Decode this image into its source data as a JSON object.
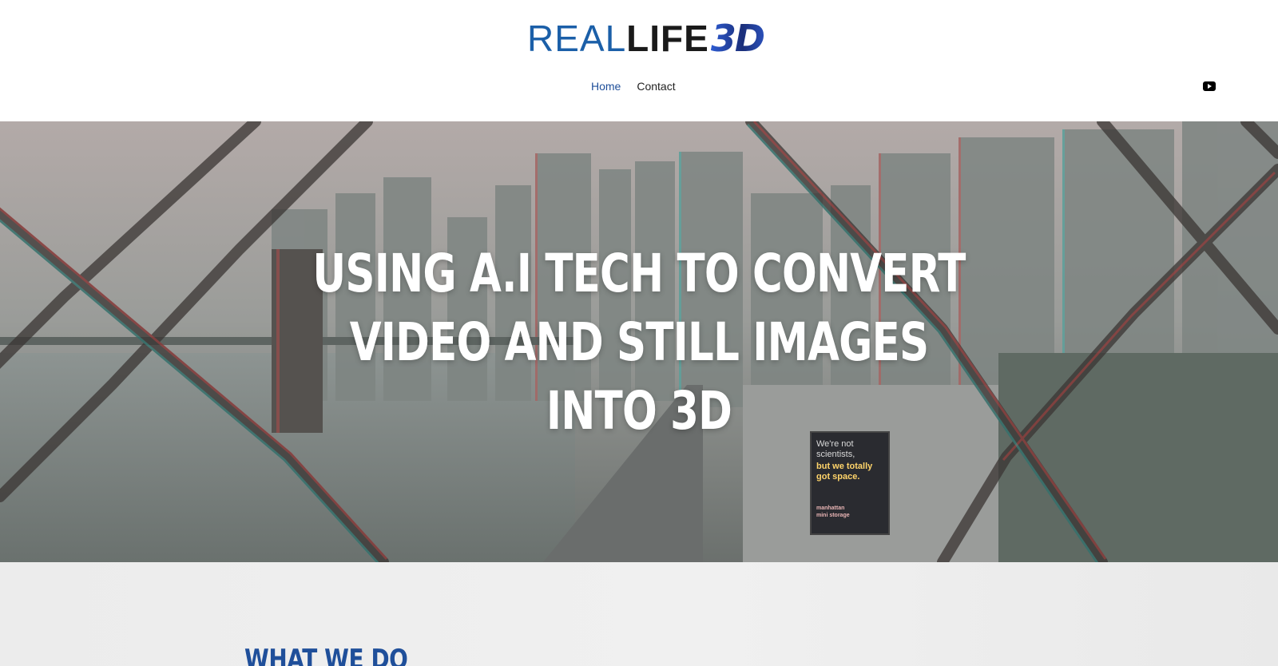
{
  "brand": {
    "logo_real": "REAL",
    "logo_life": "LIFE",
    "logo_3d": "3D",
    "colors": {
      "primary": "#1f4f9a",
      "logo_blue": "#1b5fa8",
      "dark": "#1a1a1a"
    }
  },
  "nav": {
    "items": [
      {
        "label": "Home",
        "active": true
      },
      {
        "label": "Contact",
        "active": false
      }
    ]
  },
  "social": {
    "icon": "youtube-icon"
  },
  "hero": {
    "lines": [
      "Using A.I tech to convert",
      "video and still images",
      "into 3D"
    ],
    "billboard": {
      "line1a": "We're not",
      "line1b": "scientists,",
      "line2a": "but we totally",
      "line2b": "got space.",
      "brand_a": "manhattan",
      "brand_b": "mini storage"
    }
  },
  "section": {
    "title": "What we do"
  }
}
